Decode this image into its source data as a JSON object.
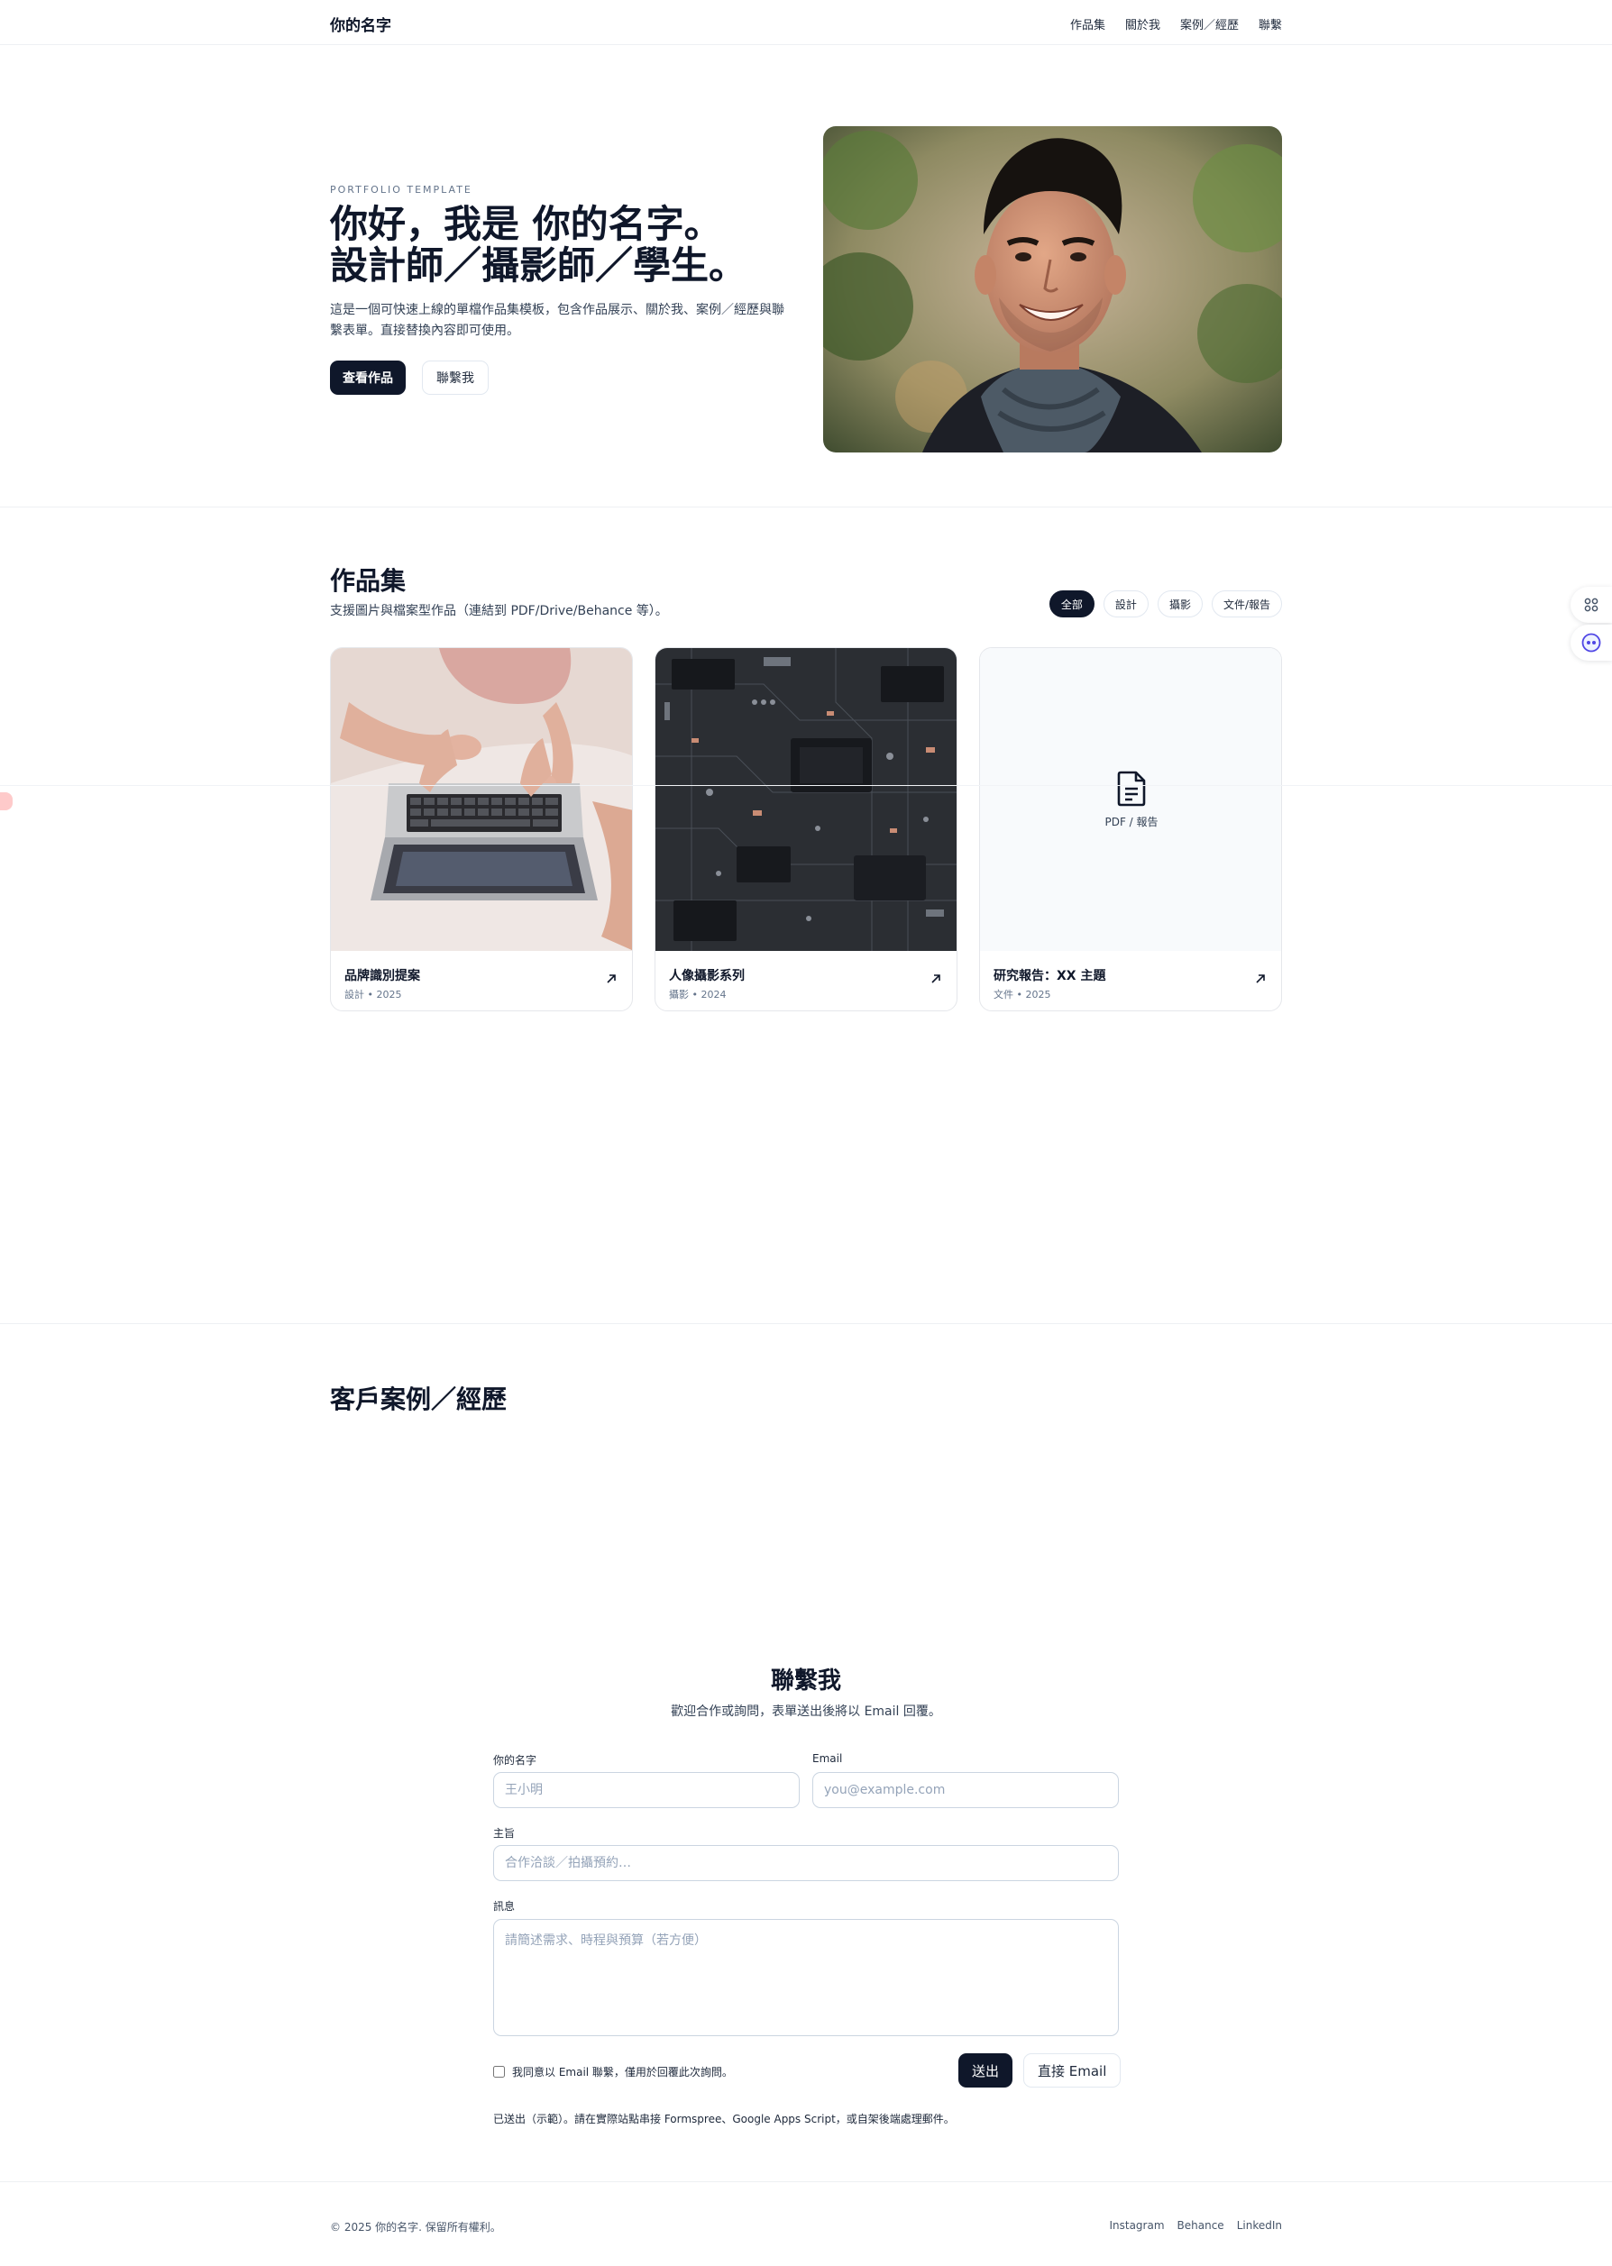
{
  "header": {
    "brand": "你的名字",
    "nav": [
      "作品集",
      "關於我",
      "案例／經歷",
      "聯繫"
    ]
  },
  "hero": {
    "eyebrow": "PORTFOLIO TEMPLATE",
    "title_line1": "你好，我是 你的名字。",
    "title_line2": "設計師／攝影師／學生。",
    "description": "這是一個可快速上線的單檔作品集模板，包含作品展示、關於我、案例／經歷與聯繫表單。直接替換內容即可使用。",
    "primary_button": "查看作品",
    "secondary_button": "聯繫我"
  },
  "portfolio": {
    "title": "作品集",
    "subtitle": "支援圖片與檔案型作品（連結到 PDF/Drive/Behance 等）。",
    "filters": [
      "全部",
      "設計",
      "攝影",
      "文件/報告"
    ],
    "active_filter": "全部",
    "cards": [
      {
        "title": "品牌識別提案",
        "meta": "設計 • 2025",
        "media": "laptop-photo"
      },
      {
        "title": "人像攝影系列",
        "meta": "攝影 • 2024",
        "media": "circuit-board-photo"
      },
      {
        "title": "研究報告：XX 主題",
        "meta": "文件 • 2025",
        "media": "document-icon",
        "placeholder_label": "PDF / 報告"
      }
    ]
  },
  "cases": {
    "title": "客戶案例／經歷"
  },
  "contact": {
    "title": "聯繫我",
    "subtitle": "歡迎合作或詢問，表單送出後將以 Email 回覆。",
    "name_label": "你的名字",
    "name_placeholder": "王小明",
    "email_label": "Email",
    "email_placeholder": "you@example.com",
    "subject_label": "主旨",
    "subject_placeholder": "合作洽談／拍攝預約…",
    "message_label": "訊息",
    "message_placeholder": "請簡述需求、時程與預算（若方便）",
    "consent": "我同意以 Email 聯繫，僅用於回覆此次詢問。",
    "send_button": "送出",
    "email_button": "直接 Email",
    "status_note": "已送出（示範）。請在實際站點串接 Formspree、Google Apps Script，或自架後端處理郵件。"
  },
  "footer": {
    "copyright": "© 2025 你的名字. 保留所有權利。",
    "links": [
      "Instagram",
      "Behance",
      "LinkedIn"
    ]
  },
  "colors": {
    "primary": "#0f172a",
    "text_secondary": "#334155",
    "border": "#e2e8f0",
    "muted_bg": "#f8fafc"
  }
}
